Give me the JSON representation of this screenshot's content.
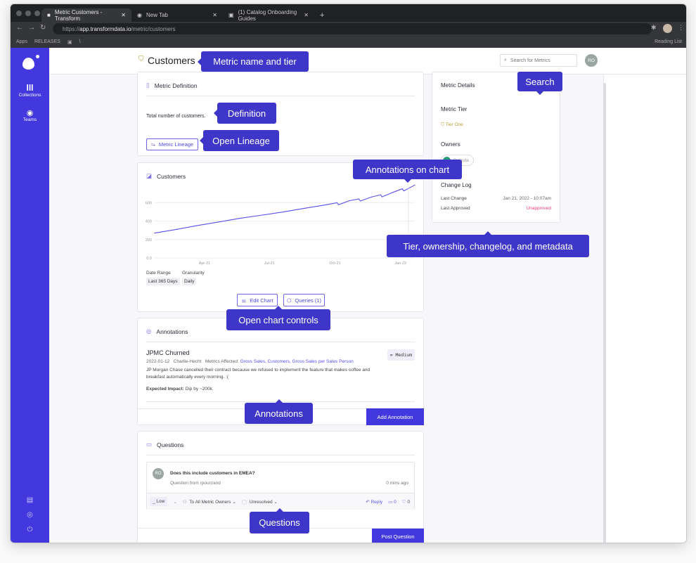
{
  "browser": {
    "tabs": [
      {
        "label": "Metric Customers - Transform",
        "active": true
      },
      {
        "label": "New Tab"
      },
      {
        "label": "(1) Catalog Onboarding Guides"
      }
    ],
    "url_prefix": "https://",
    "url_host": "app.transformdata.io",
    "url_path": "/metric/customers",
    "bookmarks": [
      "Apps",
      "RELEASES",
      "\\"
    ],
    "reading_list": "Reading List"
  },
  "sidebar": {
    "items": [
      {
        "label": "Collections",
        "icon": "collections-icon"
      },
      {
        "label": "Teams",
        "icon": "teams-icon"
      }
    ],
    "bottom_icons": [
      "docs-icon",
      "help-icon",
      "logout-icon"
    ]
  },
  "header": {
    "title": "Customers",
    "search_placeholder": "Search for Metrics",
    "avatar": "RO"
  },
  "definition": {
    "title": "Metric Definition",
    "text": "Total number of customers.",
    "lineage_button": "Metric Lineage"
  },
  "chart": {
    "title": "Customers",
    "date_range_label": "Date Range",
    "date_range": "Last 365 Days",
    "granularity_label": "Granularity",
    "granularity": "Daily",
    "edit_button": "Edit Chart",
    "queries_button": "Queries (1)"
  },
  "chart_data": {
    "type": "line",
    "x": [
      "2021-01-21",
      "2021-02-21",
      "2021-03-21",
      "2021-04-21",
      "2021-05-21",
      "2021-06-21",
      "2021-07-21",
      "2021-08-21",
      "2021-09-21",
      "2021-10-21",
      "2021-11-21",
      "2021-12-21",
      "2022-01-21"
    ],
    "values": [
      270,
      310,
      350,
      390,
      430,
      465,
      500,
      540,
      580,
      620,
      660,
      710,
      790
    ],
    "x_ticks": [
      "Apr-21",
      "Jul-21",
      "Oct-21",
      "Jan-22"
    ],
    "y_ticks": [
      "0.0",
      "200",
      "400",
      "600"
    ],
    "ylim": [
      0,
      800
    ],
    "grid": true,
    "color": "#5b50e8"
  },
  "annotations": {
    "title": "Annotations",
    "items": [
      {
        "title": "JPMC Churned",
        "date": "2022-01-12",
        "author": "Charlie-Hecht",
        "metrics_label": "Metrics Affected:",
        "metrics": "Gross Sales, Customers, Gross Sales per Sales Person",
        "priority": "Medium",
        "body": "JP Morgan Chase cancelled their contract because we refused to implement the feature that makes coffee and breakfast automatically every morning. :(",
        "impact_label": "Expected Impact:",
        "impact": "Dip by ~200k."
      }
    ],
    "add_button": "Add Annotation"
  },
  "questions": {
    "title": "Questions",
    "items": [
      {
        "avatar": "RO",
        "text": "Does this include customers in EMEA?",
        "from": "Question from rpourzand",
        "time": "0 mins ago",
        "priority": "Low",
        "audience": "To All Metric Owners",
        "status": "Unresolved",
        "reply": "Reply",
        "comments": "0",
        "likes": "0"
      }
    ],
    "post_button": "Post Question"
  },
  "details": {
    "title": "Metric Details",
    "tier_label": "Metric Tier",
    "tier": "Tier One",
    "owners_label": "Owners",
    "owner": "Belinda",
    "changelog_label": "Change Log",
    "last_change_label": "Last Change",
    "last_change": "Jan 21, 2022 - 10:07am",
    "last_approved_label": "Last Approved",
    "last_approved": "Unapproved"
  },
  "callouts": {
    "name": "Metric name and tier",
    "search": "Search",
    "definition": "Definition",
    "lineage": "Open Lineage",
    "chart_ann": "Annotations on chart",
    "meta": "Tier, ownership, changelog, and metadata",
    "controls": "Open chart controls",
    "annotations": "Annotations",
    "questions": "Questions"
  },
  "colors": {
    "accent": "#4338dd",
    "tier": "#b59a2c",
    "unapproved": "#f0437a"
  }
}
